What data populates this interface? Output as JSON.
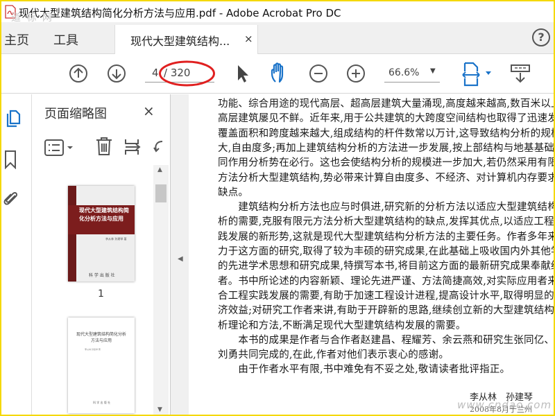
{
  "window": {
    "title": "现代大型建筑结构简化分析方法与应用.pdf - Adobe Acrobat Pro DC"
  },
  "watermarks": {
    "top": "道 标 网",
    "bottom": "www.cndao.com"
  },
  "tabs": {
    "home": "主页",
    "tools": "工具",
    "document": "现代大型建筑结构...",
    "close": "×"
  },
  "toolbar": {
    "current_page": "4",
    "total_pages": "/ 320",
    "zoom": "66.6%",
    "help": "?"
  },
  "panel": {
    "title": "页面缩略图",
    "close": "×",
    "thumb1_title": "现代大型建筑结构简化分析方法与应用",
    "thumb1_authors": "李从林 孙建琴 著",
    "thumb1_publisher": "科 学 出 版 社",
    "thumb1_number": "1",
    "thumb2_title": "现代大型建筑结构简化分析方法与应用",
    "thumb2_authors": "李从林 孙建琴 著",
    "thumb2_publisher": "科 学 出 版 社"
  },
  "document": {
    "lines": [
      "功能、综合用途的现代高层、超高层建筑大量涌现,高度越来越高,数百米以上的超",
      "高层建筑屡见不鲜。近年来,用于公共建筑的大跨度空间结构也取得了迅速发展,",
      "覆盖面积和跨度越来越大,组成结构的杆件数常以万计,这导致结构分析的规模巨",
      "大,自由度多;再加上建筑结构分析的方法进一步发展,按上部结构与地基基础共",
      "同作用分析势在必行。这也会使结构分析的规模进一步加大,若仍然采用有限元",
      "方法分析大型建筑结构,势必带来计算自由度多、不经济、对计算机内存要求高等",
      "缺点。",
      "　　建筑结构分析方法也应与时俱进,研究新的分析方法以适应大型建筑结构分",
      "析的需要,克服有限元方法分析大型建筑结构的缺点,发挥其优点,以适应工程实",
      "践发展的新形势,这就是现代大型建筑结构分析方法的主要任务。作者多年来致",
      "力于这方面的研究,取得了较为丰硕的研究成果,在此基础上吸收国内外其他学者",
      "的先进学术思想和研究成果,特撰写本书,将目前这方面的最新研究成果奉献给读",
      "者。书中所论述的内容新颖、理论先进严谨、方法简捷高效,对实际应用者来讲,符",
      "合工程实践发展的需要,有助于加速工程设计进程,提高设计水平,取得明显的经",
      "济效益;对研究工作者来讲,有助于开辟新的思路,继续创立新的大型建筑结构分",
      "析理论和方法,不断满足现代大型建筑结构发展的需要。",
      "　　本书的成果是作者与合作者赵建昌、程耀芳、余云燕和研究生张同亿、王忠礼、",
      "刘勇共同完成的,在此,作者对他们表示衷心的感谢。",
      "　　由于作者水平有限,书中难免有不妥之处,敬请读者批评指正。"
    ],
    "signature": "李从林　孙建琴",
    "date": "2008年8月于兰州"
  },
  "colors": {
    "frame": "#f5d800",
    "annotation_red": "#e02020",
    "accent_blue": "#1a73c9",
    "cover_red": "#7c1d1d"
  }
}
